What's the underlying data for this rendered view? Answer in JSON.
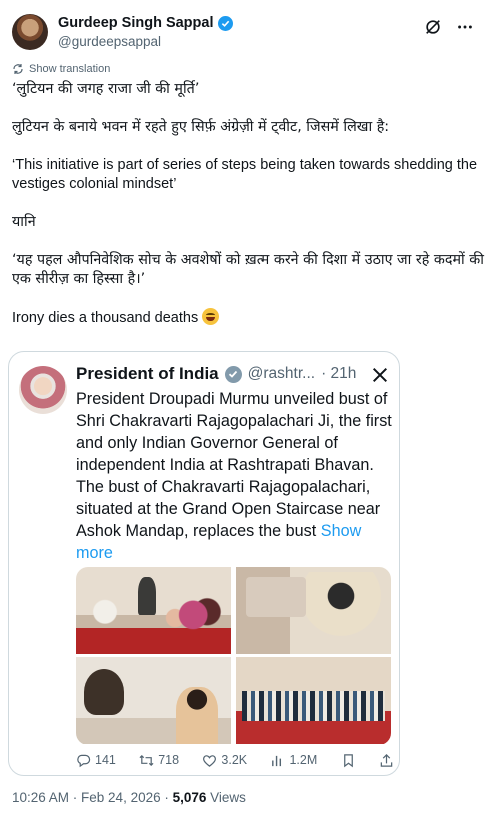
{
  "author": {
    "name": "Gurdeep Singh Sappal",
    "handle": "@gurdeepsappal"
  },
  "show_translation": "Show translation",
  "tweet": {
    "lines": [
      "‘लुटियन की जगह राजा जी की मूर्ति’",
      "लुटियन के बनाये भवन में रहते हुए सिर्फ़ अंग्रेज़ी में ट्वीट, जिसमें लिखा है:",
      "‘This initiative is part of series of steps being taken towards shedding the vestiges colonial mindset’",
      "यानि",
      "‘यह पहल औपनिवेशिक सोच के अवशेषों को ख़त्म करने की दिशा में उठाए जा रहे कदमों की एक सीरीज़ का हिस्सा है।’",
      "Irony dies a thousand deaths"
    ]
  },
  "quoted": {
    "name": "President of India",
    "handle": "@rashtr...",
    "time": "· 21h",
    "text": "President Droupadi Murmu unveiled bust of Shri Chakravarti Rajagopalachari Ji, the first and only Indian Governor General of independent India at Rashtrapati Bhavan. The bust of Chakravarti Rajagopalachari, situated at the Grand Open Staircase near Ashok Mandap, replaces the bust",
    "show_more": "Show more",
    "stats": {
      "replies": "141",
      "reposts": "718",
      "likes": "3.2K",
      "views": "1.2M"
    }
  },
  "footer": {
    "time": "10:26 AM · Feb 24, 2026 · ",
    "views_count": "5,076",
    "views_label": " Views"
  },
  "colors": {
    "link": "#1d9bf0",
    "muted": "#536471",
    "verified": "#1d9bf0",
    "gov_verified": "#829aab"
  }
}
